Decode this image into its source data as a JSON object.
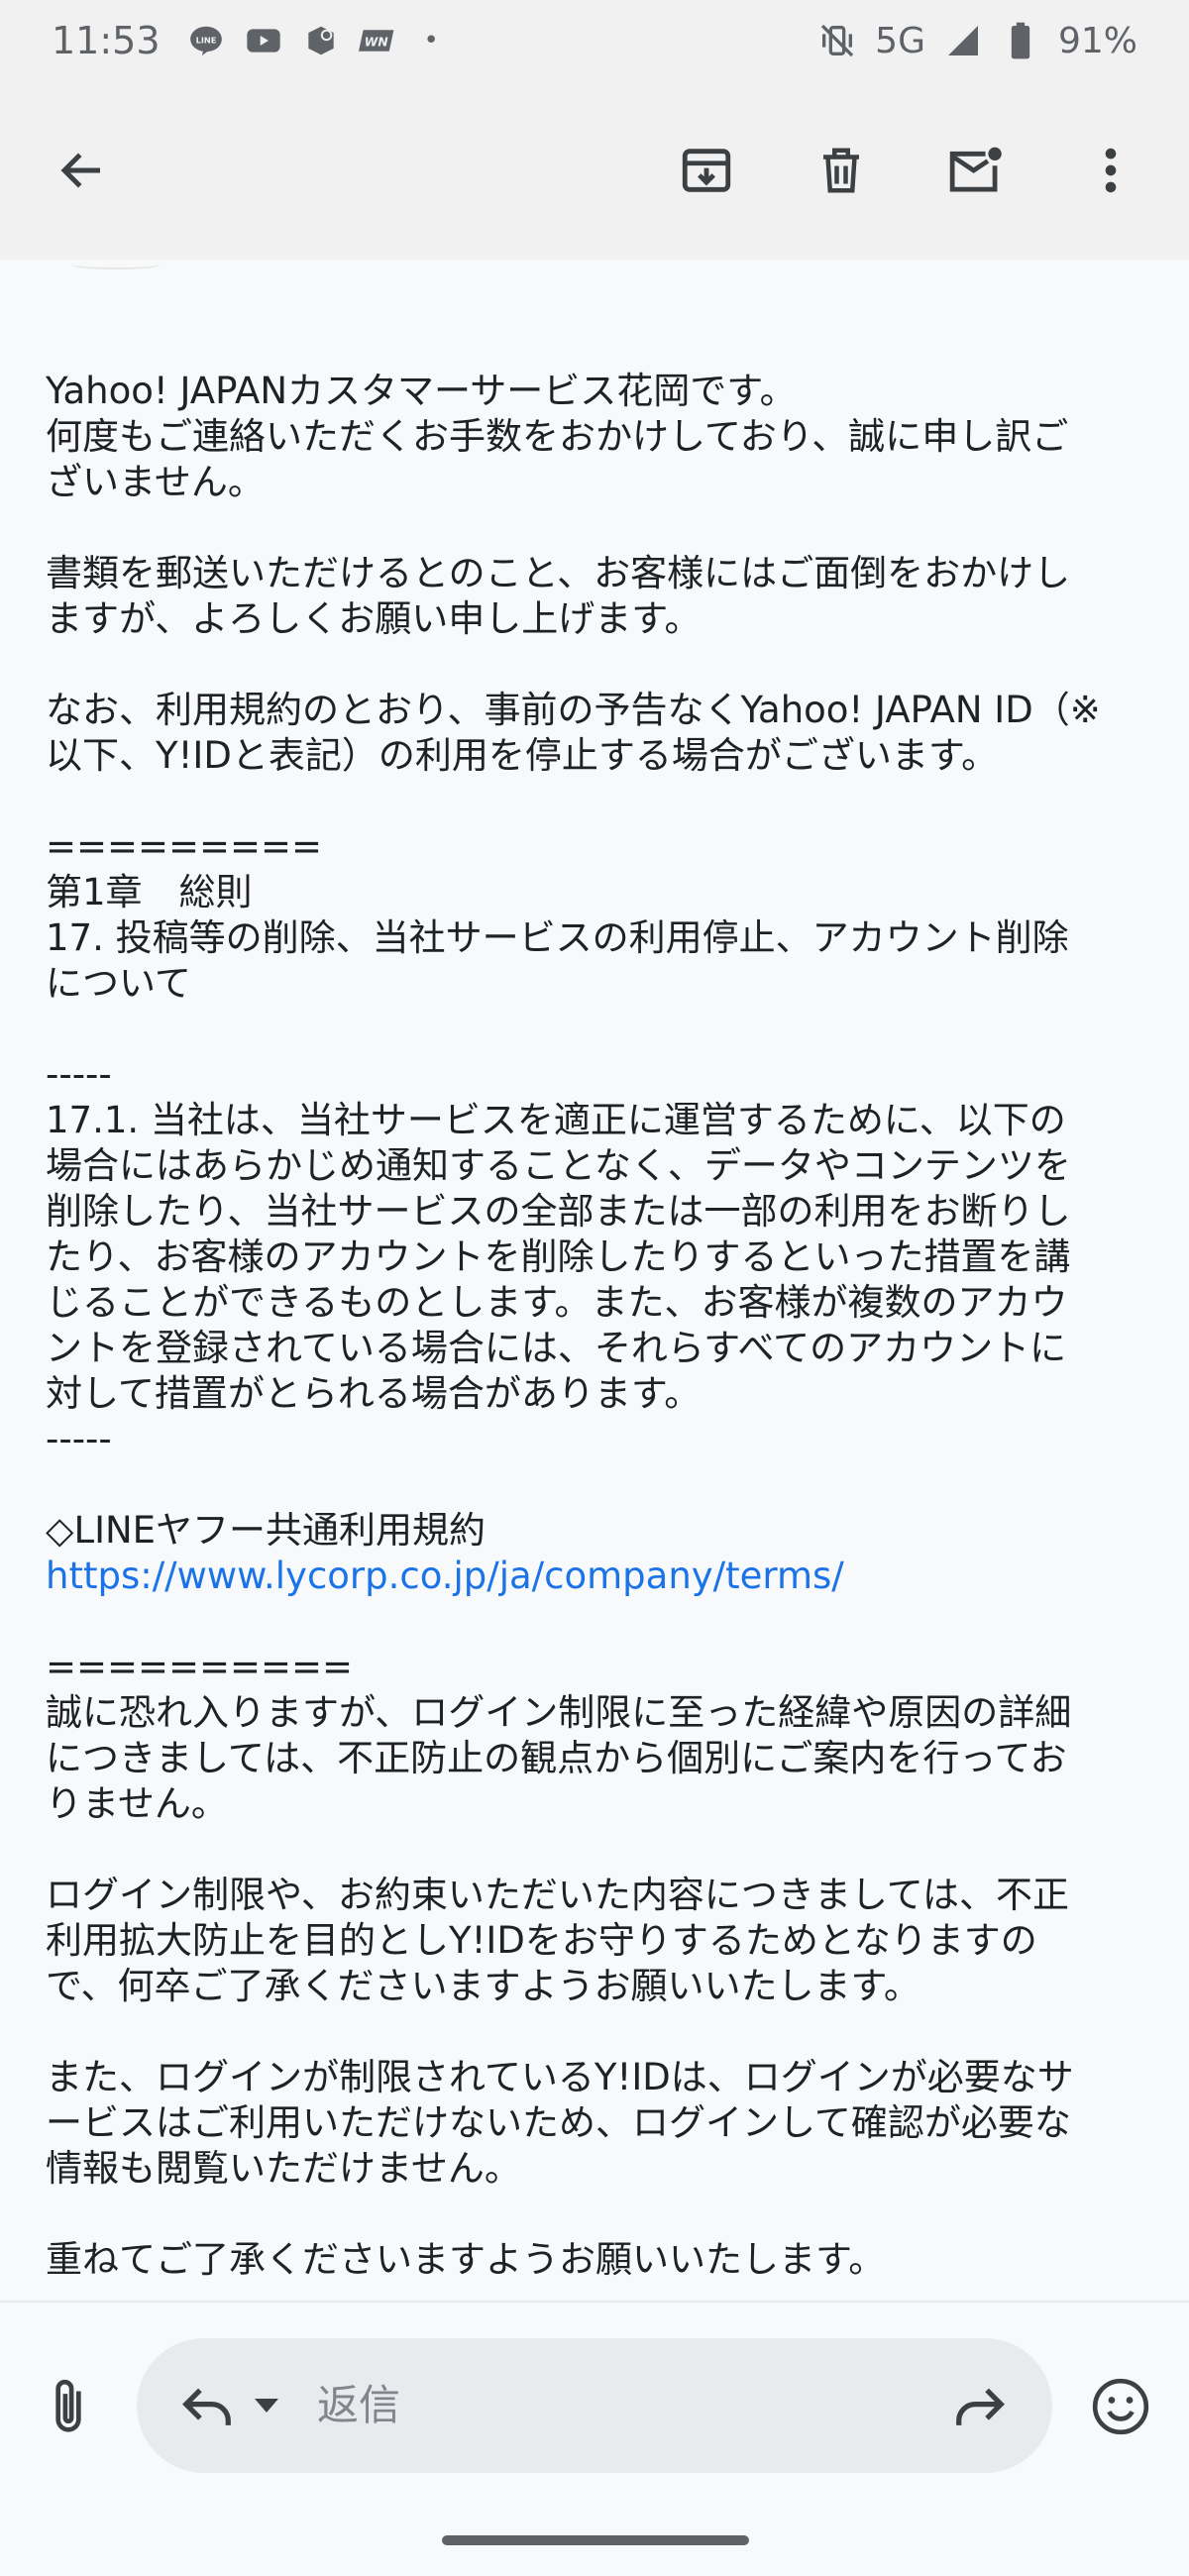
{
  "status_bar": {
    "time": "11:53",
    "app_icons": [
      "line-icon",
      "youtube-icon",
      "app-icon",
      "wn-icon"
    ],
    "dot": "•",
    "network": "5G",
    "battery": "91%"
  },
  "toolbar": {
    "back_icon": "back-arrow-icon",
    "archive_icon": "archive-icon",
    "delete_icon": "delete-icon",
    "mark_unread_icon": "mark-unread-icon",
    "more_icon": "more-vert-icon"
  },
  "email": {
    "paragraphs": [
      {
        "lines": [
          "Yahoo! JAPANカスタマーサービス花岡です。",
          "何度もご連絡いただくお手数をおかけしており、誠に申し訳ご",
          "ざいません。"
        ]
      },
      {
        "lines": [
          "書類を郵送いただけるとのこと、お客様にはご面倒をおかけし",
          "ますが、よろしくお願い申し上げます。"
        ]
      },
      {
        "lines": [
          "なお、利用規約のとおり、事前の予告なくYahoo! JAPAN ID（※",
          "以下、Y!IDと表記）の利用を停止する場合がございます。"
        ]
      },
      {
        "lines": [
          "=========",
          "第1章　総則",
          "17. 投稿等の削除、当社サービスの利用停止、アカウント削除",
          "について"
        ]
      },
      {
        "lines": [
          "-----",
          "17.1. 当社は、当社サービスを適正に運営するために、以下の",
          "場合にはあらかじめ通知することなく、データやコンテンツを",
          "削除したり、当社サービスの全部または一部の利用をお断りし",
          "たり、お客様のアカウントを削除したりするといった措置を講",
          "じることができるものとします。また、お客様が複数のアカウ",
          "ントを登録されている場合には、それらすべてのアカウントに",
          "対して措置がとられる場合があります。",
          "-----"
        ]
      },
      {
        "lines": [
          "◇LINEヤフー共通利用規約"
        ],
        "link": "https://www.lycorp.co.jp/ja/company/terms/"
      },
      {
        "lines": [
          "==========",
          "誠に恐れ入りますが、ログイン制限に至った経緯や原因の詳細",
          "につきましては、不正防止の観点から個別にご案内を行ってお",
          "りません。"
        ]
      },
      {
        "lines": [
          "ログイン制限や、お約束いただいた内容につきましては、不正",
          "利用拡大防止を目的としY!IDをお守りするためとなりますの",
          "で、何卒ご了承くださいますようお願いいたします。"
        ]
      },
      {
        "lines": [
          "また、ログインが制限されているY!IDは、ログインが必要なサ",
          "ービスはご利用いただけないため、ログインして確認が必要な",
          "情報も閲覧いただけません。"
        ]
      },
      {
        "lines": [
          "重ねてご了承くださいますようお願いいたします。"
        ]
      }
    ]
  },
  "reply_bar": {
    "attach_icon": "attachment-icon",
    "reply_icon": "reply-icon",
    "caret_icon": "chevron-down-icon",
    "placeholder": "返信",
    "forward_icon": "forward-icon",
    "emoji_icon": "emoji-icon"
  },
  "colors": {
    "link": "#1a73e8",
    "text": "#202124",
    "toolbar_bg": "#f1f1f1",
    "page_bg": "#f8f9fa",
    "reply_pill": "#e8eaed"
  }
}
